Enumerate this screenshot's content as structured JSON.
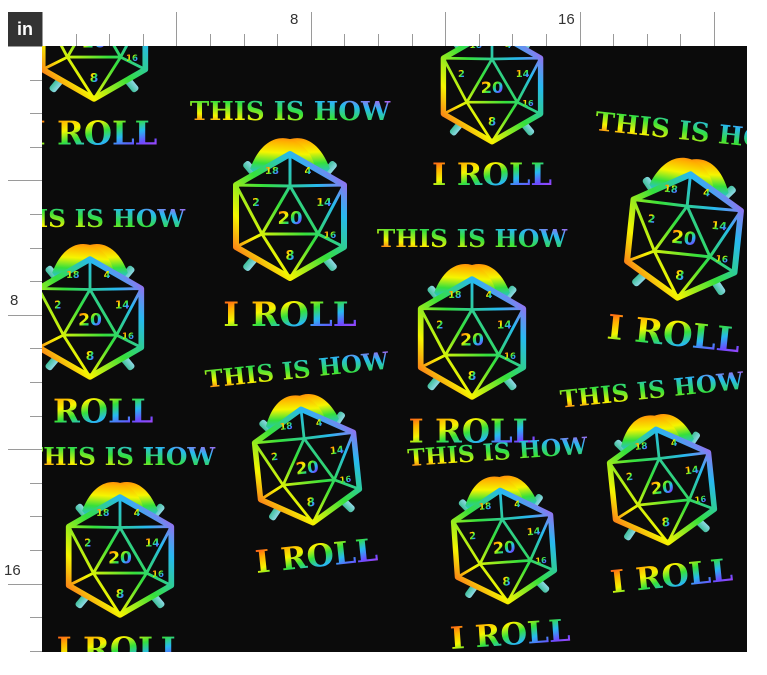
{
  "ruler": {
    "unit": "in",
    "top_labels": [
      "8",
      "16"
    ],
    "side_labels": [
      "8",
      "16"
    ]
  },
  "fabric": {
    "phrase_top": "THIS IS HOW",
    "phrase_bottom": "I ROLL",
    "die_faces": [
      "20",
      "2",
      "14",
      "8",
      "18",
      "4",
      "16"
    ],
    "background_color": "#0b0b0b",
    "gradient_colors": [
      "#ff2a2a",
      "#ffb000",
      "#f5f500",
      "#35e03c",
      "#27b9f0",
      "#6a4cff",
      "#e23ef0"
    ]
  }
}
